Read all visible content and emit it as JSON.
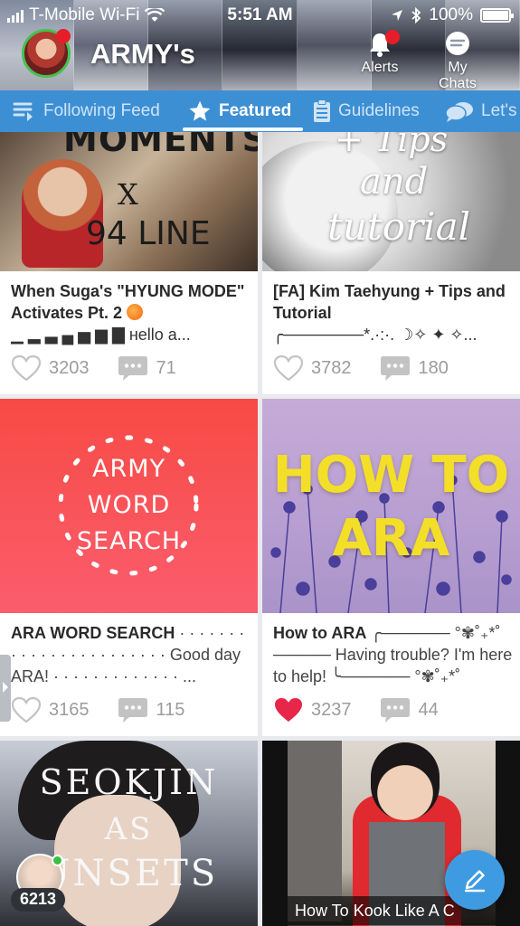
{
  "status_bar": {
    "carrier": "T-Mobile Wi-Fi",
    "time": "5:51 AM",
    "battery": "100%"
  },
  "header": {
    "community_title": "ARMY's",
    "alerts_label": "Alerts",
    "chats_label": "My Chats"
  },
  "tabs": [
    {
      "label": "Following Feed",
      "icon": "feed-icon",
      "active": false
    },
    {
      "label": "Featured",
      "icon": "star-icon",
      "active": true
    },
    {
      "label": "Guidelines",
      "icon": "clipboard-icon",
      "active": false
    },
    {
      "label": "Let's",
      "icon": "chat-bubbles-icon",
      "active": false
    }
  ],
  "posts": [
    {
      "title_bold": "When Suga's \"HYUNG MODE\" Activates Pt. 2",
      "title_rest": "",
      "snippet": "▁ ▂ ▃ ▄ ▅ ▆ ▇ нello a...",
      "thumb_text": [
        "MOMENTS",
        "X",
        "94 LINE"
      ],
      "likes": "3203",
      "comments": "71",
      "liked": false
    },
    {
      "title_bold": "[FA] Kim Taehyung + Tips and Tutorial",
      "title_rest": "",
      "snippet": "╭───────*.·:·. ☽✧    ✦    ✧...",
      "thumb_text": [
        "+ Tips",
        "and",
        "tutorial"
      ],
      "likes": "3782",
      "comments": "180",
      "liked": false
    },
    {
      "title_bold": "ARA WORD SEARCH",
      "title_rest": " · · · · · · · · · · · · · · · · · · · · · · · Good day ARA! · · · · · · · · · · · · · ...",
      "snippet": "",
      "thumb_text": [
        "ARMY",
        "WORD",
        "SEARCH"
      ],
      "likes": "3165",
      "comments": "115",
      "liked": false
    },
    {
      "title_bold": "How to ARA",
      "title_rest": " ╭────── °✾˚₊*˚ ───── Having trouble? I'm here to help! ╰────── °✾˚₊*˚",
      "snippet": "",
      "thumb_text": [
        "HOW TO",
        "ARA"
      ],
      "likes": "3237",
      "comments": "44",
      "liked": true
    }
  ],
  "bottom_cards": [
    {
      "thumb_text": [
        "SEOKJIN",
        "AS",
        "UNSETS"
      ]
    },
    {
      "thumb_text": [
        "How To Kook Like A C"
      ]
    }
  ],
  "online_bubble": {
    "count": "6213"
  },
  "colors": {
    "tabbar": "#3d8fd4",
    "accent": "#3e9be2",
    "like_active": "#e8264a",
    "notification": "#e81d2a",
    "online": "#3bc044"
  }
}
